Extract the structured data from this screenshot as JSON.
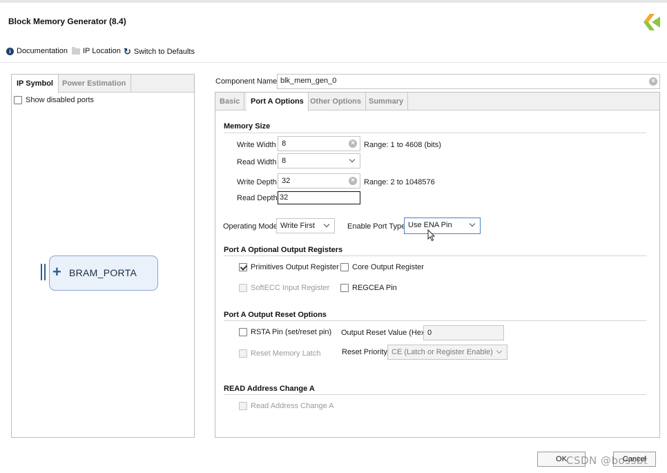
{
  "window": {
    "title": "Block Memory Generator (8.4)"
  },
  "toolbar": {
    "documentation": "Documentation",
    "ip_location": "IP Location",
    "switch_defaults": "Switch to Defaults"
  },
  "left_panel": {
    "tabs": [
      {
        "label": "IP Symbol",
        "active": true
      },
      {
        "label": "Power Estimation",
        "active": false
      }
    ],
    "show_disabled_ports": {
      "label": "Show disabled ports",
      "checked": false
    },
    "symbol": {
      "label": "BRAM_PORTA"
    }
  },
  "component_name": {
    "label": "Component Name",
    "value": "blk_mem_gen_0"
  },
  "right_tabs": [
    {
      "label": "Basic",
      "active": false
    },
    {
      "label": "Port A Options",
      "active": true
    },
    {
      "label": "Other Options",
      "active": false
    },
    {
      "label": "Summary",
      "active": false
    }
  ],
  "memory_size": {
    "heading": "Memory Size",
    "write_width": {
      "label": "Write Width",
      "value": "8",
      "range": "Range: 1 to 4608 (bits)"
    },
    "read_width": {
      "label": "Read Width",
      "value": "8"
    },
    "write_depth": {
      "label": "Write Depth",
      "value": "32",
      "range": "Range: 2 to 1048576"
    },
    "read_depth": {
      "label": "Read Depth",
      "value": "32"
    }
  },
  "operating_mode": {
    "label": "Operating Mode",
    "value": "Write First"
  },
  "enable_port_type": {
    "label": "Enable Port Type",
    "value": "Use ENA Pin"
  },
  "output_registers": {
    "heading": "Port A Optional Output Registers",
    "primitives": {
      "label": "Primitives Output Register",
      "checked": true
    },
    "core": {
      "label": "Core Output Register",
      "checked": false
    },
    "softecc": {
      "label": "SoftECC Input Register",
      "checked": false,
      "disabled": true
    },
    "regcea": {
      "label": "REGCEA Pin",
      "checked": false
    }
  },
  "reset_options": {
    "heading": "Port A Output Reset Options",
    "rsta": {
      "label": "RSTA Pin (set/reset pin)",
      "checked": false
    },
    "output_reset_value": {
      "label": "Output Reset Value (Hex)",
      "value": "0"
    },
    "reset_memory_latch": {
      "label": "Reset Memory Latch",
      "checked": false,
      "disabled": true
    },
    "reset_priority": {
      "label": "Reset Priority",
      "value": "CE (Latch or Register Enable)"
    }
  },
  "read_address": {
    "heading": "READ Address Change A",
    "checkbox": {
      "label": "Read Address Change A",
      "checked": false,
      "disabled": true
    }
  },
  "buttons": {
    "ok": "OK",
    "cancel": "Cancel"
  },
  "watermark": "CSDN @bossbt",
  "colors": {
    "accent_blue": "#4b7fc4",
    "symbol_fill": "#eaf1fb",
    "logo_green": "#8cc63f"
  },
  "icons": [
    "info-icon",
    "folder-icon",
    "refresh-icon",
    "clear-icon",
    "chevron-down-icon",
    "checkbox-icon",
    "plus-icon",
    "cursor-icon"
  ]
}
